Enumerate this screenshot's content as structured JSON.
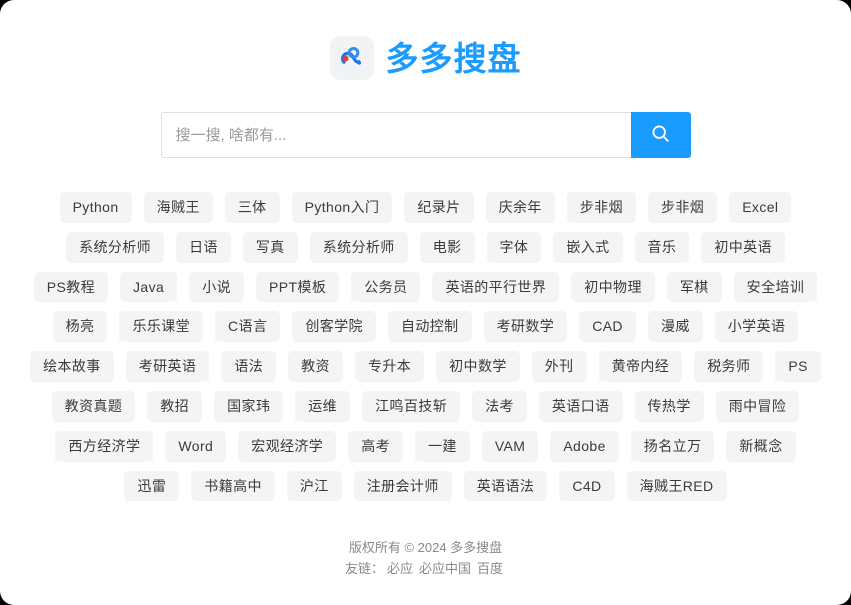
{
  "site": {
    "logo_icon": "cloud-disk-logo-icon",
    "title": "多多搜盘",
    "brand_color": "#1a9bff"
  },
  "search": {
    "placeholder": "搜一搜, 啥都有...",
    "value": "",
    "button_icon": "search-icon",
    "button_color": "#1a9bff"
  },
  "tags": [
    "Python",
    "海贼王",
    "三体",
    "Python入门",
    "纪录片",
    "庆余年",
    "步非烟",
    "步非烟",
    "Excel",
    "系统分析师",
    "日语",
    "写真",
    "系统分析师",
    "电影",
    "字体",
    "嵌入式",
    "音乐",
    "初中英语",
    "PS教程",
    "Java",
    "小说",
    "PPT模板",
    "公务员",
    "英语的平行世界",
    "初中物理",
    "军棋",
    "安全培训",
    "杨亮",
    "乐乐课堂",
    "C语言",
    "创客学院",
    "自动控制",
    "考研数学",
    "CAD",
    "漫威",
    "小学英语",
    "绘本故事",
    "考研英语",
    "语法",
    "教资",
    "专升本",
    "初中数学",
    "外刊",
    "黄帝内经",
    "税务师",
    "PS",
    "教资真题",
    "教招",
    "国家玮",
    "运维",
    "江鸣百技斩",
    "法考",
    "英语口语",
    "传热学",
    "雨中冒险",
    "西方经济学",
    "Word",
    "宏观经济学",
    "高考",
    "一建",
    "VAM",
    "Adobe",
    "扬名立万",
    "新概念",
    "迅雷",
    "书籍高中",
    "沪江",
    "注册会计师",
    "英语语法",
    "C4D",
    "海贼王RED"
  ],
  "footer": {
    "copyright": "版权所有 © 2024 多多搜盘",
    "friend_label": "友链：",
    "links": [
      "必应",
      "必应中国",
      "百度"
    ]
  }
}
